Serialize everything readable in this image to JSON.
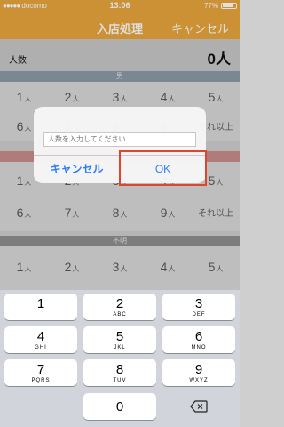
{
  "status": {
    "carrier": "docomo",
    "time": "13:06",
    "battery": "77%",
    "battery_level": 0.77
  },
  "nav": {
    "title": "入店処理",
    "cancel": "キャンセル"
  },
  "count": {
    "label": "人数",
    "value": "0人"
  },
  "sections": {
    "male": "男",
    "female": "女",
    "unknown": "不明"
  },
  "grid": {
    "unit": "人",
    "row1": [
      "1",
      "2",
      "3",
      "4",
      "5"
    ],
    "row2": [
      "6",
      "7",
      "8",
      "9",
      "それ以上"
    ]
  },
  "alert": {
    "placeholder": "人数を入力してください",
    "cancel": "キャンセル",
    "ok": "OK"
  },
  "keypad": [
    {
      "num": "1",
      "sub": ""
    },
    {
      "num": "2",
      "sub": "ABC"
    },
    {
      "num": "3",
      "sub": "DEF"
    },
    {
      "num": "4",
      "sub": "GHI"
    },
    {
      "num": "5",
      "sub": "JKL"
    },
    {
      "num": "6",
      "sub": "MNO"
    },
    {
      "num": "7",
      "sub": "PQRS"
    },
    {
      "num": "8",
      "sub": "TUV"
    },
    {
      "num": "9",
      "sub": "WXYZ"
    },
    {
      "num": "0",
      "sub": ""
    }
  ],
  "colors": {
    "accent": "#e8a53c",
    "link": "#2f7cf6",
    "highlight": "#e0442c"
  }
}
